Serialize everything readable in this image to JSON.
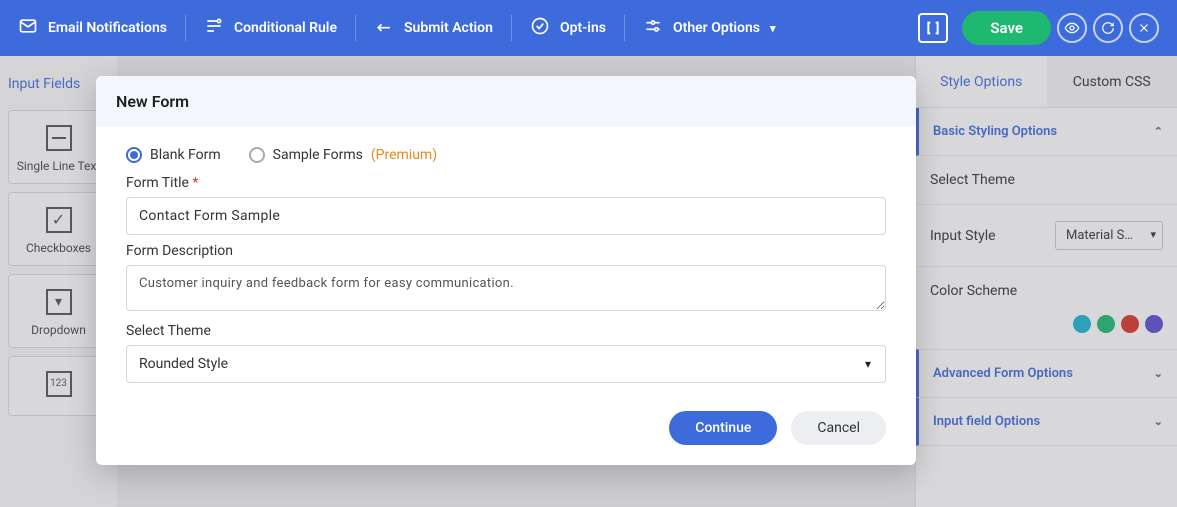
{
  "toolbar": {
    "items": [
      {
        "label": "Email Notifications",
        "icon": "mail-icon"
      },
      {
        "label": "Conditional Rule",
        "icon": "conditional-icon"
      },
      {
        "label": "Submit Action",
        "icon": "submit-icon"
      },
      {
        "label": "Opt-ins",
        "icon": "optins-icon"
      },
      {
        "label": "Other Options",
        "icon": "options-icon",
        "has_chevron": true
      }
    ],
    "save_label": "Save"
  },
  "left_panel": {
    "tab": "Input Fields",
    "tiles": [
      {
        "label": "Single Line Text"
      },
      {
        "label": "Checkboxes"
      },
      {
        "label": "Dropdown"
      },
      {
        "label": ""
      }
    ]
  },
  "right_panel": {
    "tabs": [
      "Style Options",
      "Custom CSS"
    ],
    "basic_styling": "Basic Styling Options",
    "select_theme": "Select Theme",
    "input_style_label": "Input Style",
    "input_style_value": "Material S…",
    "color_scheme": "Color Scheme",
    "colors": [
      "#1eb4d4",
      "#1eb871",
      "#d9342b",
      "#5a4ed1"
    ],
    "advanced": "Advanced Form Options",
    "input_field": "Input field Options"
  },
  "modal": {
    "title": "New Form",
    "radio_blank": "Blank Form",
    "radio_sample": "Sample Forms",
    "premium": "(Premium)",
    "form_title_label": "Form Title",
    "form_title_value": "Contact Form Sample",
    "desc_label": "Form Description",
    "desc_value": "Customer inquiry and feedback form for easy communication.",
    "theme_label": "Select Theme",
    "theme_value": "Rounded Style",
    "continue": "Continue",
    "cancel": "Cancel"
  }
}
